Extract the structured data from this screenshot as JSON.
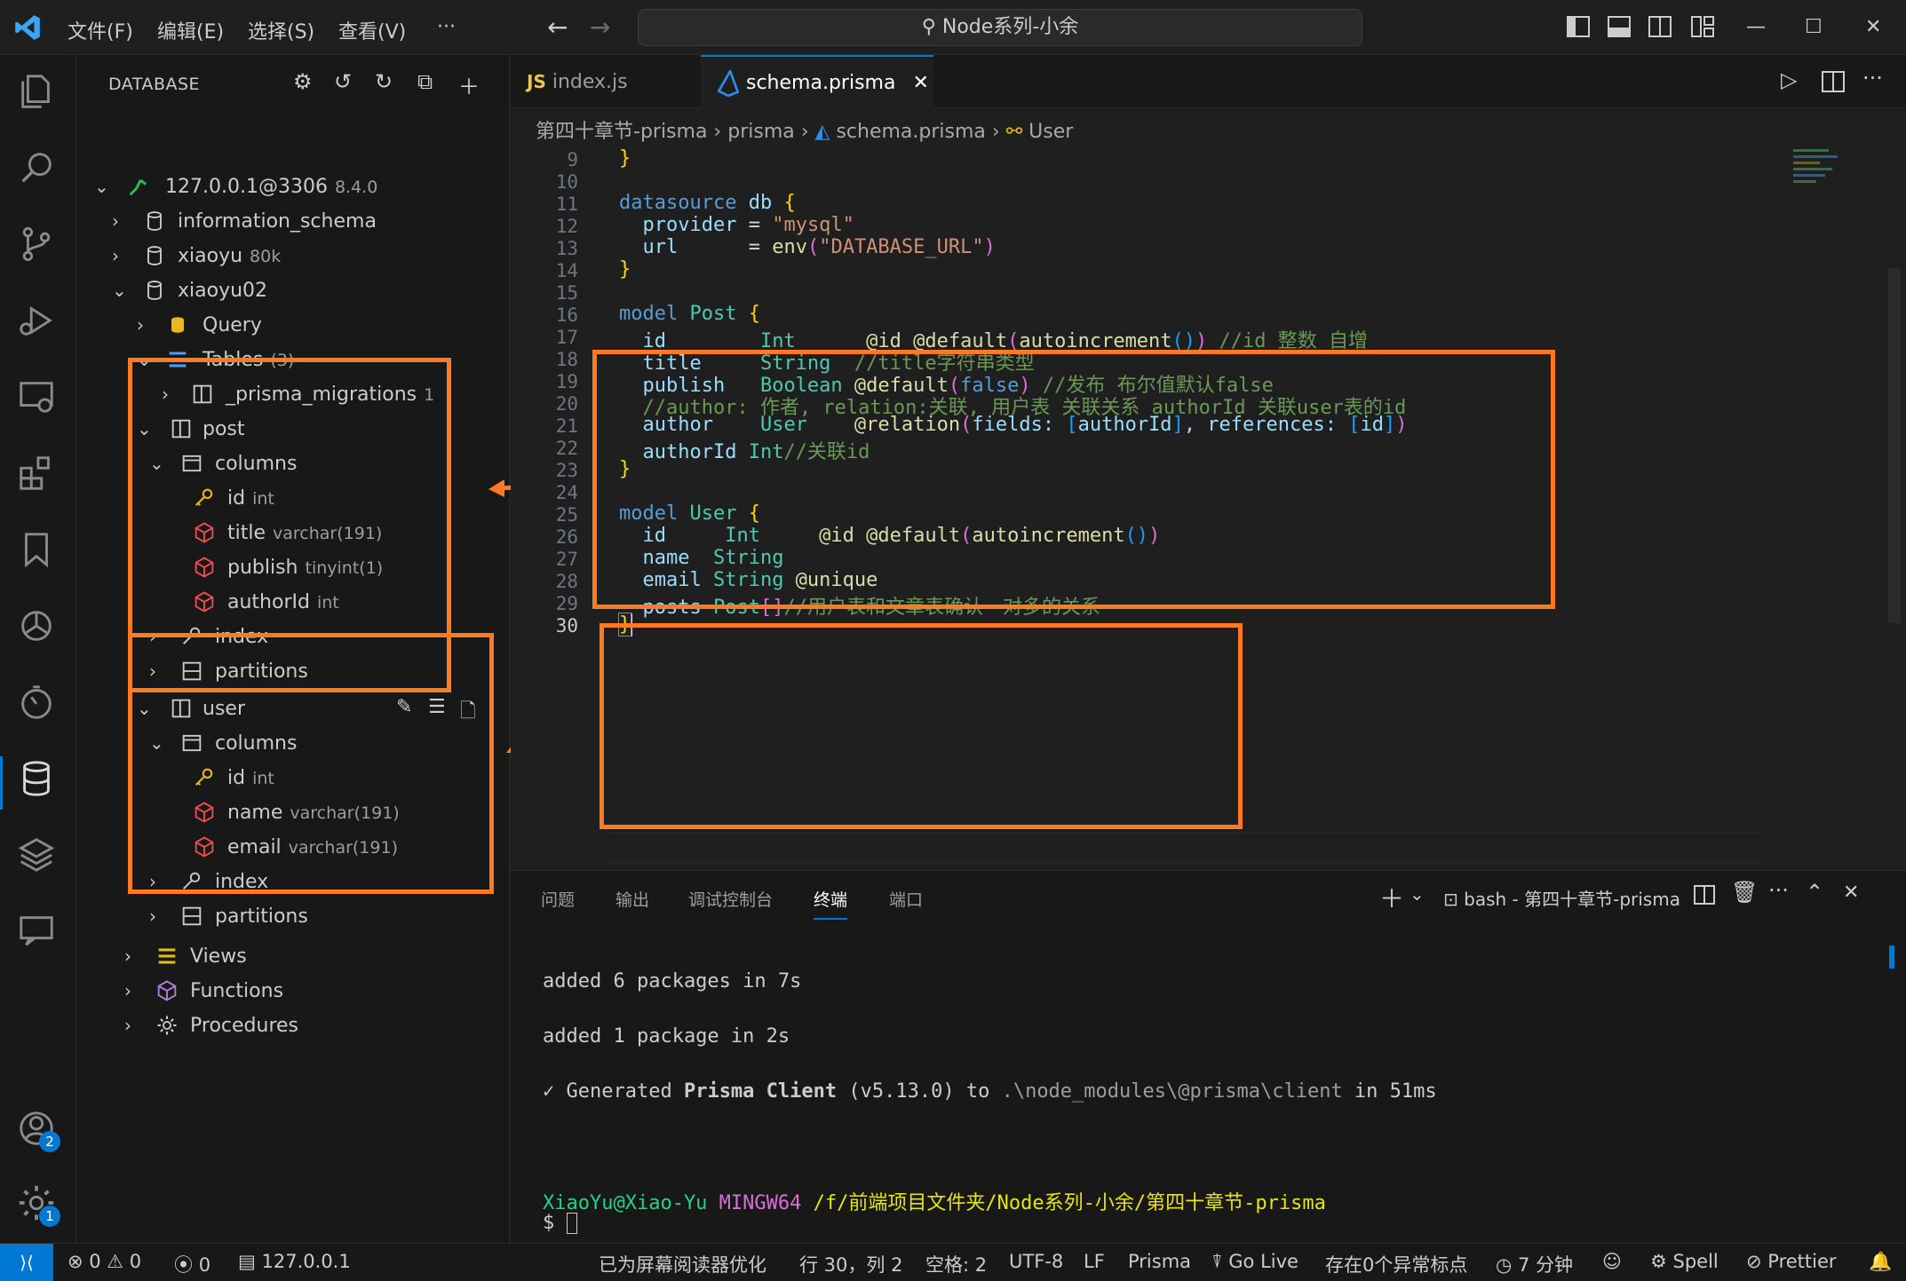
{
  "titlebar": {
    "menus": [
      "文件(F)",
      "编辑(E)",
      "选择(S)",
      "查看(V)",
      "···"
    ],
    "command_center": "Node系列-小余"
  },
  "sidebar": {
    "title": "DATABASE",
    "tree": [
      {
        "label": "127.0.0.1@3306",
        "sub": "8.4.0"
      },
      {
        "label": "information_schema",
        "sub": ""
      },
      {
        "label": "xiaoyu",
        "sub": "80k"
      },
      {
        "label": "xiaoyu02",
        "sub": ""
      },
      {
        "label": "Query",
        "sub": ""
      },
      {
        "label": "Tables",
        "sub": "(3)"
      },
      {
        "label": "_prisma_migrations",
        "sub": "1"
      },
      {
        "label": "post",
        "sub": ""
      },
      {
        "label": "columns",
        "sub": ""
      },
      {
        "label": "id",
        "sub": "int"
      },
      {
        "label": "title",
        "sub": "varchar(191)"
      },
      {
        "label": "publish",
        "sub": "tinyint(1)"
      },
      {
        "label": "authorId",
        "sub": "int"
      },
      {
        "label": "index",
        "sub": ""
      },
      {
        "label": "partitions",
        "sub": ""
      },
      {
        "label": "user",
        "sub": ""
      },
      {
        "label": "columns",
        "sub": ""
      },
      {
        "label": "id",
        "sub": "int"
      },
      {
        "label": "name",
        "sub": "varchar(191)"
      },
      {
        "label": "email",
        "sub": "varchar(191)"
      },
      {
        "label": "index",
        "sub": ""
      },
      {
        "label": "partitions",
        "sub": ""
      },
      {
        "label": "Views",
        "sub": ""
      },
      {
        "label": "Functions",
        "sub": ""
      },
      {
        "label": "Procedures",
        "sub": ""
      }
    ]
  },
  "editor": {
    "tabs": [
      {
        "icon": "JS",
        "label": "index.js"
      },
      {
        "icon": "",
        "label": "schema.prisma"
      }
    ],
    "breadcrumb": [
      "第四十章节-prisma",
      "prisma",
      "schema.prisma",
      "User"
    ],
    "line_numbers": [
      "9",
      "10",
      "11",
      "12",
      "13",
      "14",
      "15",
      "16",
      "17",
      "18",
      "19",
      "20",
      "21",
      "22",
      "23",
      "24",
      "25",
      "26",
      "27",
      "28",
      "29",
      "30"
    ],
    "code": {
      "l9": "}",
      "l11a": "datasource",
      "l11b": " db ",
      "l11c": "{",
      "l12a": "  provider",
      "l12b": " = ",
      "l12c": "\"mysql\"",
      "l13a": "  url",
      "l13b": "      = ",
      "l13c": "env",
      "l13d": "(",
      "l13e": "\"DATABASE_URL\"",
      "l13f": ")",
      "l14": "}",
      "l16a": "model",
      "l16b": " Post ",
      "l16c": "{",
      "l17a": "  id",
      "l17b": "        Int",
      "l17c": "      @id @default",
      "l17d": "(",
      "l17e": "autoincrement",
      "l17f": "()",
      "l17g": ")",
      "l17h": " //id 整数 自增",
      "l18a": "  title",
      "l18b": "     String",
      "l18c": "  //title字符串类型",
      "l19a": "  publish",
      "l19b": "   Boolean",
      "l19c": " @default",
      "l19d": "(",
      "l19e": "false",
      "l19f": ")",
      "l19g": " //发布 布尔值默认false",
      "l20": "  //author: 作者, relation:关联, 用户表 关联关系 authorId 关联user表的id",
      "l21a": "  author",
      "l21b": "    User",
      "l21c": "    @relation",
      "l21d": "(",
      "l21e": "fields: ",
      "l21f": "[",
      "l21g": "authorId",
      "l21h": "]",
      "l21i": ", references: ",
      "l21j": "[",
      "l21k": "id",
      "l21l": "]",
      "l21m": ")",
      "l22a": "  authorId",
      "l22b": " Int",
      "l22c": "//关联id",
      "l23": "}",
      "l25a": "model",
      "l25b": " User ",
      "l25c": "{",
      "l26a": "  id",
      "l26b": "     Int",
      "l26c": "     @id @default",
      "l26d": "(",
      "l26e": "autoincrement",
      "l26f": "()",
      "l26g": ")",
      "l27a": "  name",
      "l27b": "  String",
      "l28a": "  email",
      "l28b": " String",
      "l28c": " @unique",
      "l29a": "  posts",
      "l29b": " Post",
      "l29c": "[]",
      "l29d": "//用户表和文章表确认一对多的关系",
      "l30": "}"
    }
  },
  "panel": {
    "tabs": [
      "问题",
      "输出",
      "调试控制台",
      "终端",
      "端口"
    ],
    "terminal_name": "bash - 第四十章节-prisma",
    "lines": {
      "t1": "added 6 packages in 7s",
      "t2": "added 1 package in 2s",
      "t3a": "✓ Generated ",
      "t3b": "Prisma Client",
      "t3c": " (v5.13.0) to ",
      "t3d": ".\\node_modules\\@prisma\\client",
      "t3e": " in 51ms",
      "t4a": "XiaoYu@Xiao-Yu",
      "t4b": " MINGW64 ",
      "t4c": "/f/前端项目文件夹/Node系列-小余/第四十章节-prisma",
      "t5": "$ "
    }
  },
  "statusbar": {
    "remote": "⟩⟨",
    "errors": "⊗ 0 ⚠ 0",
    "ports": "0",
    "db": "127.0.0.1",
    "screenreader": "已为屏幕阅读器优化",
    "position": "行 30，列 2",
    "spaces": "空格: 2",
    "encoding": "UTF-8",
    "eol": "LF",
    "language": "Prisma",
    "golive": "Go Live",
    "problems": "存在0个异常标点",
    "time": "7 分钟",
    "spell": "Spell",
    "prettier": "Prettier"
  },
  "badges": {
    "accounts": "2",
    "settings": "1"
  },
  "colors": {
    "accent": "#0078d4",
    "highlight": "#ff7a21",
    "keyword": "#569cd6",
    "type": "#4ec9b0",
    "string": "#ce9178",
    "comment": "#6a9955"
  }
}
